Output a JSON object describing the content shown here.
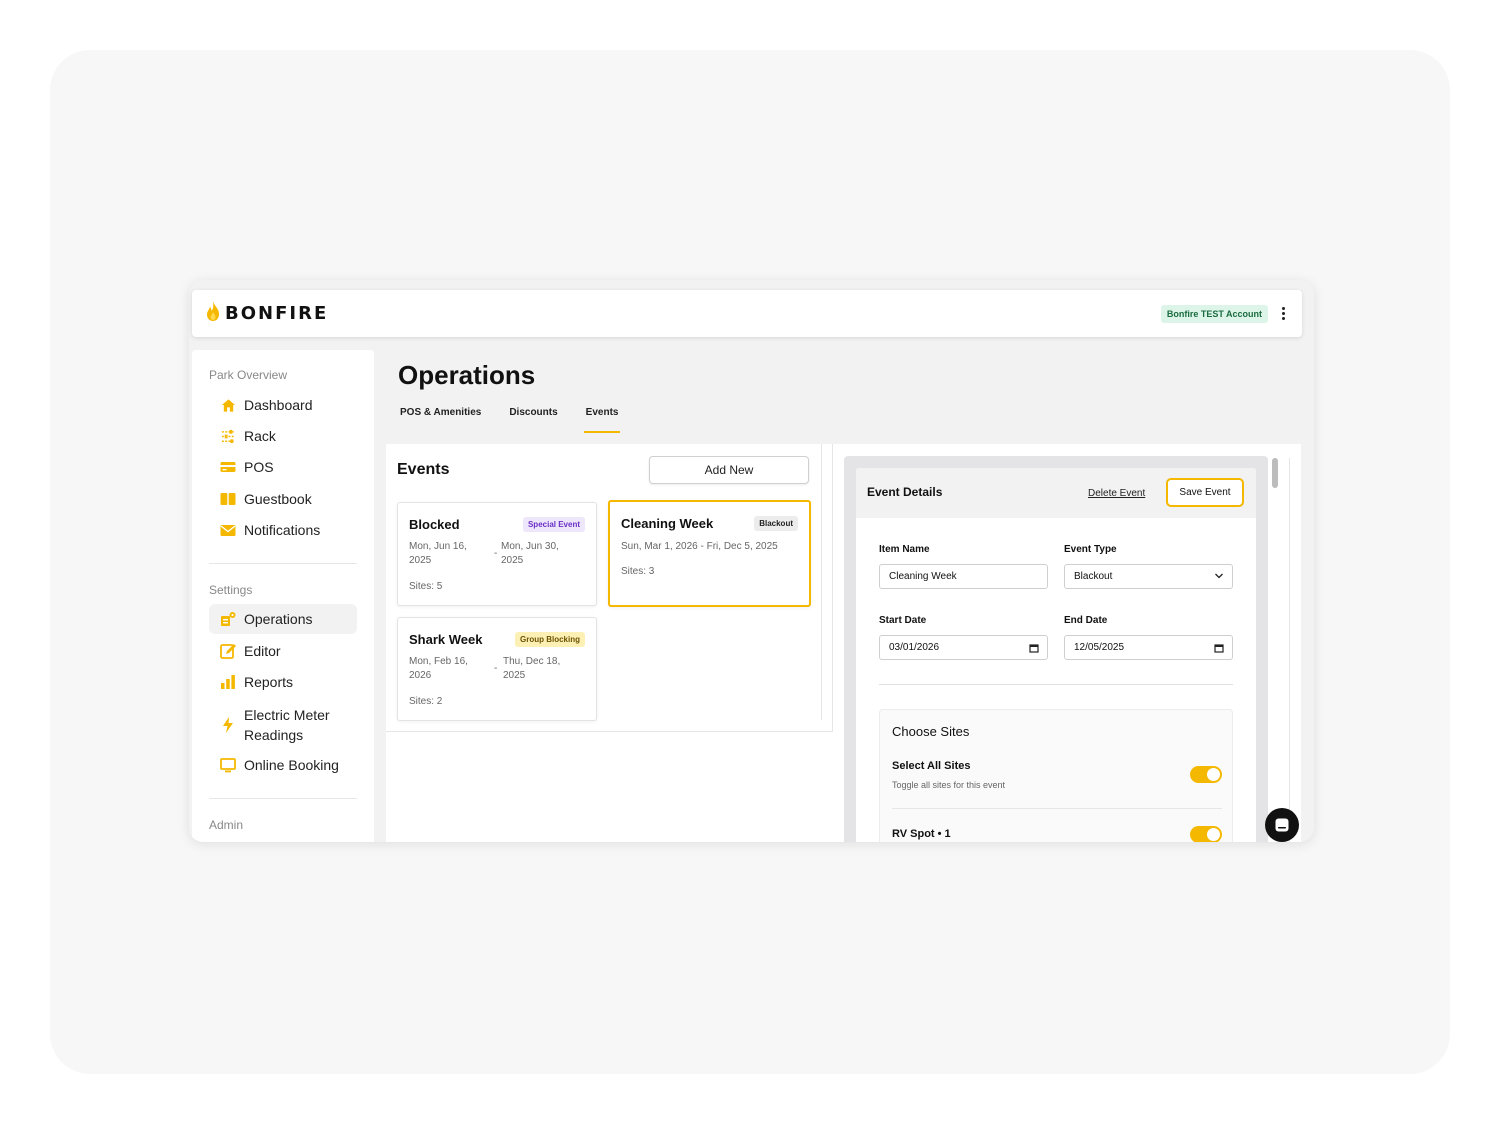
{
  "app": {
    "brand": "BONFIRE",
    "account_badge": "Bonfire TEST Account"
  },
  "sidebar": {
    "sections": [
      {
        "label": "Park Overview",
        "items": [
          {
            "label": "Dashboard",
            "icon": "home-icon"
          },
          {
            "label": "Rack",
            "icon": "sliders-icon"
          },
          {
            "label": "POS",
            "icon": "credit-card-icon"
          },
          {
            "label": "Guestbook",
            "icon": "book-icon"
          },
          {
            "label": "Notifications",
            "icon": "envelope-icon"
          }
        ]
      },
      {
        "label": "Settings",
        "items": [
          {
            "label": "Operations",
            "icon": "operations-icon",
            "active": true
          },
          {
            "label": "Editor",
            "icon": "edit-icon"
          },
          {
            "label": "Reports",
            "icon": "bar-chart-icon"
          },
          {
            "label": "Electric Meter Readings",
            "label_line1": "Electric Meter",
            "label_line2": "Readings",
            "icon": "lightning-icon"
          },
          {
            "label": "Online Booking",
            "icon": "monitor-icon"
          }
        ]
      },
      {
        "label": "Admin",
        "items": []
      }
    ]
  },
  "page": {
    "title": "Operations",
    "tabs": [
      {
        "label": "POS & Amenities",
        "active": false
      },
      {
        "label": "Discounts",
        "active": false
      },
      {
        "label": "Events",
        "active": true
      }
    ]
  },
  "events": {
    "title": "Events",
    "add_new_label": "Add New",
    "cards": [
      {
        "name": "Blocked",
        "badge": "Special Event",
        "date_start": "Mon, Jun 16, 2025",
        "date_start_l1": "Mon, Jun 16,",
        "date_start_l2": "2025",
        "dash": "-",
        "date_end_l1": "Mon, Jun 30,",
        "date_end_l2": "2025",
        "sites": "Sites: 5"
      },
      {
        "name": "Cleaning Week",
        "badge": "Blackout",
        "date_range": "Sun, Mar 1, 2026 - Fri, Dec 5, 2025",
        "sites": "Sites: 3",
        "selected": true
      },
      {
        "name": "Shark Week",
        "badge": "Group Blocking",
        "date_start_l1": "Mon, Feb 16,",
        "date_start_l2": "2026",
        "dash": "-",
        "date_end_l1": "Thu, Dec 18,",
        "date_end_l2": "2025",
        "sites": "Sites: 2"
      }
    ]
  },
  "event_details": {
    "title": "Event Details",
    "delete_label": "Delete Event",
    "save_label": "Save Event",
    "item_name_label": "Item Name",
    "item_name_value": "Cleaning Week",
    "event_type_label": "Event Type",
    "event_type_value": "Blackout",
    "start_date_label": "Start Date",
    "start_date_value": "03/01/2026",
    "end_date_label": "End Date",
    "end_date_value": "12/05/2025",
    "choose_sites_title": "Choose Sites",
    "select_all_label": "Select All Sites",
    "select_all_sub": "Toggle all sites for this event",
    "select_all_on": true,
    "next_site_label": "RV Spot • 1",
    "next_site_on": true
  },
  "colors": {
    "accent": "#f5b800",
    "badge_green_bg": "#dcf5e8",
    "badge_green_text": "#1b6b3f"
  }
}
